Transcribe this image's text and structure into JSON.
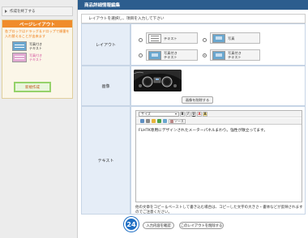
{
  "sidebar": {
    "close_label": "作成を終了する",
    "layout_title": "ページレイアウト",
    "layout_desc": "各ブロックはドラッグ＆ドロップで順番を入れ替えることが出来ます",
    "samples": [
      {
        "line1": "写真付き",
        "line2": "テキスト",
        "color": "#6aa7cf"
      },
      {
        "line1": "写真付き",
        "line2": "テキスト",
        "color": "#e0a9d1"
      }
    ],
    "new_button": "新規作成"
  },
  "main": {
    "title": "商品詳細情報編集",
    "instruction": "レイアウトを選択し、項目を入力して下さい",
    "rows": {
      "layout_label": "レイアウト",
      "image_label": "画像",
      "text_label": "テキスト"
    },
    "layout_options": [
      {
        "line1": "テキスト",
        "line2": "",
        "selected": false
      },
      {
        "line1": "写真",
        "line2": "",
        "selected": false
      },
      {
        "line1": "写真付き",
        "line2": "テキスト",
        "selected": false
      },
      {
        "line1": "写真付き",
        "line2": "テキスト",
        "selected": true
      }
    ],
    "delete_image_button": "画像を削除する",
    "editor": {
      "size_placeholder": "サイズ",
      "source_label": "ソース",
      "content": "FLHTK専用にデザインされたメーターパネルまわり。強性が散立ってます。"
    },
    "note": "他の文章をコピー＆ペーストして書き込む場合は、コピーした文字の大きさ・書体などが反映されますのでご注意ください。",
    "confirm_button": "入力内容を確認",
    "delete_layout_button": "このレイアウトを削除する",
    "step_number": "24"
  },
  "colors": {
    "accent_orange": "#f08c2c",
    "header_blue": "#2c5d8e",
    "label_bg": "#e5edf7",
    "step_badge": "#1f6fc4"
  }
}
